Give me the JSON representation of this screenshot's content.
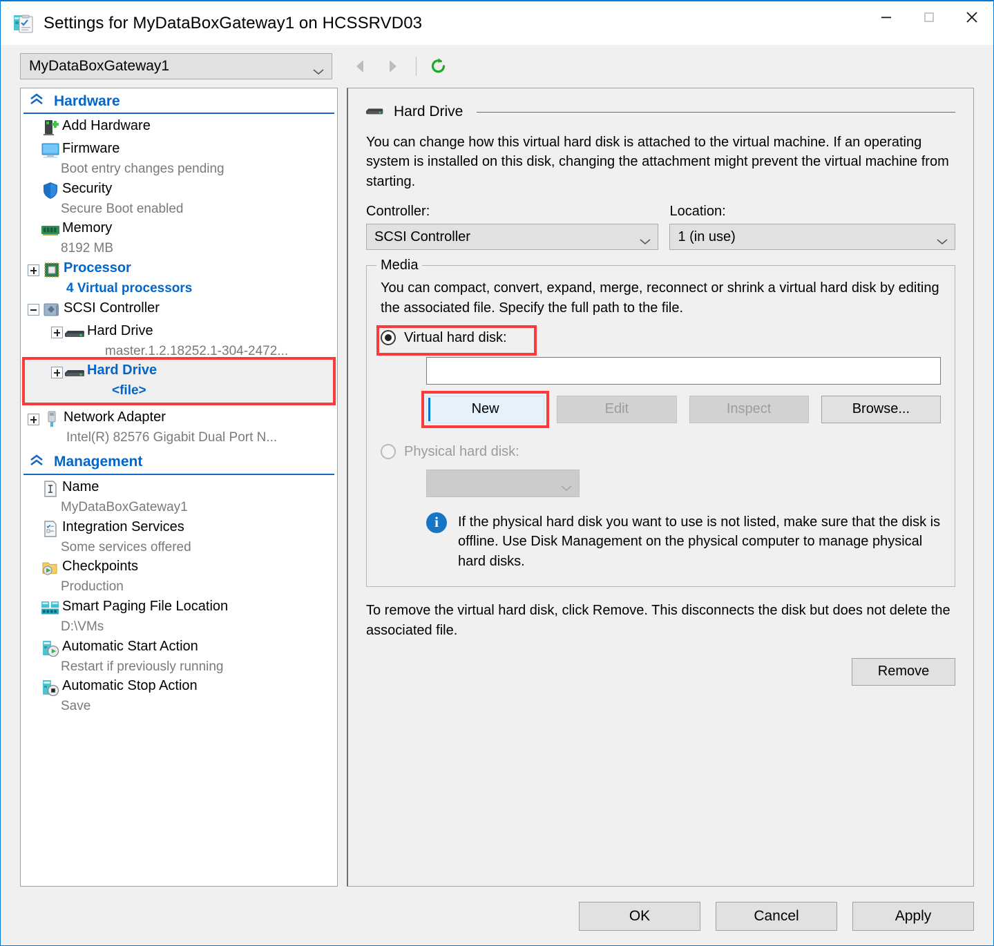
{
  "window": {
    "title": "Settings for MyDataBoxGateway1 on HCSSRVD03",
    "icon": "settings-vm-icon",
    "controls": {
      "minimize": "minimize-icon",
      "maximize": "maximize-icon",
      "close": "close-icon"
    }
  },
  "toolbar": {
    "vm_selected": "MyDataBoxGateway1",
    "back": "back-arrow-icon",
    "forward": "forward-arrow-icon",
    "refresh": "refresh-icon"
  },
  "sidebar": {
    "groups": [
      {
        "label": "Hardware",
        "items": [
          {
            "label": "Add Hardware",
            "sub": "",
            "icon": "add-hardware-icon",
            "expander": "",
            "selected": false,
            "blue": false
          },
          {
            "label": "Firmware",
            "sub": "Boot entry changes pending",
            "icon": "firmware-icon",
            "expander": "",
            "selected": false,
            "blue": false
          },
          {
            "label": "Security",
            "sub": "Secure Boot enabled",
            "icon": "security-shield-icon",
            "expander": "",
            "selected": false,
            "blue": false
          },
          {
            "label": "Memory",
            "sub": "8192 MB",
            "icon": "memory-icon",
            "expander": "",
            "selected": false,
            "blue": false
          },
          {
            "label": "Processor",
            "sub": "4 Virtual processors",
            "icon": "processor-icon",
            "expander": "plus",
            "selected": false,
            "blue": true
          },
          {
            "label": "SCSI Controller",
            "sub": "",
            "icon": "scsi-controller-icon",
            "expander": "minus",
            "selected": false,
            "blue": false
          },
          {
            "label": "Hard Drive",
            "sub": "master.1.2.18252.1-304-2472...",
            "icon": "hard-drive-icon",
            "expander": "plus",
            "selected": false,
            "blue": false,
            "indent": 2
          },
          {
            "label": "Hard Drive",
            "sub": "<file>",
            "icon": "hard-drive-icon",
            "expander": "plus",
            "selected": true,
            "blue": true,
            "indent": 2
          },
          {
            "label": "Network Adapter",
            "sub": "Intel(R) 82576 Gigabit Dual Port N...",
            "icon": "network-adapter-icon",
            "expander": "plus",
            "selected": false,
            "blue": false
          }
        ]
      },
      {
        "label": "Management",
        "items": [
          {
            "label": "Name",
            "sub": "MyDataBoxGateway1",
            "icon": "name-icon",
            "expander": "",
            "selected": false,
            "blue": false
          },
          {
            "label": "Integration Services",
            "sub": "Some services offered",
            "icon": "integration-services-icon",
            "expander": "",
            "selected": false,
            "blue": false
          },
          {
            "label": "Checkpoints",
            "sub": "Production",
            "icon": "checkpoints-icon",
            "expander": "",
            "selected": false,
            "blue": false
          },
          {
            "label": "Smart Paging File Location",
            "sub": "D:\\VMs",
            "icon": "smart-paging-icon",
            "expander": "",
            "selected": false,
            "blue": false
          },
          {
            "label": "Automatic Start Action",
            "sub": "Restart if previously running",
            "icon": "auto-start-icon",
            "expander": "",
            "selected": false,
            "blue": false
          },
          {
            "label": "Automatic Stop Action",
            "sub": "Save",
            "icon": "auto-stop-icon",
            "expander": "",
            "selected": false,
            "blue": false
          }
        ]
      }
    ]
  },
  "main": {
    "section_title": "Hard Drive",
    "section_icon": "hard-drive-icon",
    "description": "You can change how this virtual hard disk is attached to the virtual machine. If an operating system is installed on this disk, changing the attachment might prevent the virtual machine from starting.",
    "controller_label": "Controller:",
    "controller_value": "SCSI Controller",
    "location_label": "Location:",
    "location_value": "1 (in use)",
    "media": {
      "legend": "Media",
      "description": "You can compact, convert, expand, merge, reconnect or shrink a virtual hard disk by editing the associated file. Specify the full path to the file.",
      "vhd_radio_label": "Virtual hard disk:",
      "vhd_radio_checked": true,
      "vhd_path_value": "",
      "buttons": [
        {
          "label": "New",
          "state": "focused"
        },
        {
          "label": "Edit",
          "state": "disabled"
        },
        {
          "label": "Inspect",
          "state": "disabled"
        },
        {
          "label": "Browse...",
          "state": "enabled"
        }
      ],
      "physical_radio_label": "Physical hard disk:",
      "physical_radio_checked": false,
      "physical_disk_value": "",
      "info_icon": "info-icon",
      "info_text": "If the physical hard disk you want to use is not listed, make sure that the disk is offline. Use Disk Management on the physical computer to manage physical hard disks."
    },
    "remove_description": "To remove the virtual hard disk, click Remove. This disconnects the disk but does not delete the associated file.",
    "remove_button": "Remove"
  },
  "footer": {
    "ok": "OK",
    "cancel": "Cancel",
    "apply": "Apply"
  },
  "colors": {
    "accent": "#0078d7",
    "link_blue": "#0066cc",
    "highlight_red": "#fb3b3b",
    "refresh_green": "#1faa1f"
  }
}
